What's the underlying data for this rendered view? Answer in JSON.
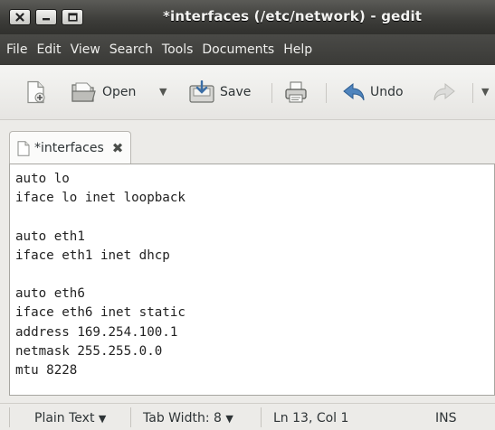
{
  "window": {
    "title": "*interfaces (/etc/network) - gedit"
  },
  "menubar": {
    "items": [
      "File",
      "Edit",
      "View",
      "Search",
      "Tools",
      "Documents",
      "Help"
    ]
  },
  "toolbar": {
    "open_label": "Open",
    "open_arrow": "▼",
    "save_label": "Save",
    "undo_label": "Undo",
    "more_arrow": "▼"
  },
  "tab": {
    "label": "*interfaces",
    "close_glyph": "✖"
  },
  "editor": {
    "lines": [
      "auto lo",
      "iface lo inet loopback",
      "",
      "auto eth1",
      "iface eth1 inet dhcp",
      "",
      "auto eth6",
      "iface eth6 inet static",
      "address 169.254.100.1",
      "netmask 255.255.0.0",
      "mtu 8228"
    ]
  },
  "statusbar": {
    "language": "Plain Text",
    "language_arrow": "▼",
    "tab_width": "Tab Width: 8",
    "tab_width_arrow": "▼",
    "position": "Ln 13, Col 1",
    "mode": "INS"
  }
}
